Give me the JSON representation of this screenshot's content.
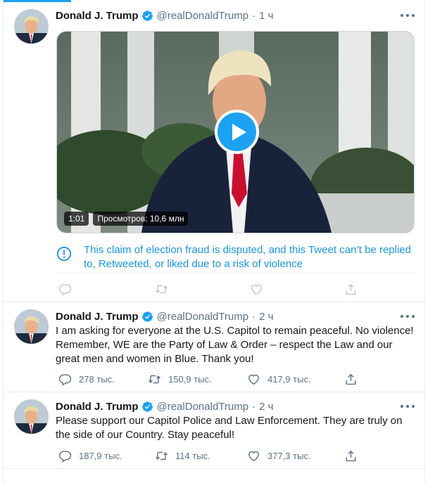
{
  "tweets": [
    {
      "name": "Donald J. Trump",
      "handle": "@realDonaldTrump",
      "time": "1 ч",
      "video": {
        "duration": "1:01",
        "views": "Просмотров: 10,6 млн"
      },
      "notice": "This claim of election fraud is disputed, and this Tweet can’t be replied to, Retweeted, or liked due to a risk of violence"
    },
    {
      "name": "Donald J. Trump",
      "handle": "@realDonaldTrump",
      "time": "2 ч",
      "text": "I am asking for everyone at the U.S. Capitol to remain peaceful. No violence! Remember, WE are the Party of Law & Order – respect the Law and our great men and women in Blue. Thank you!",
      "replies": "278 тыс.",
      "retweets": "150,9 тыс.",
      "likes": "417,9 тыс."
    },
    {
      "name": "Donald J. Trump",
      "handle": "@realDonaldTrump",
      "time": "2 ч",
      "text": "Please support our Capitol Police and Law Enforcement. They are truly on the side of our Country. Stay peaceful!",
      "replies": "187,9 тыс.",
      "retweets": "114 тыс.",
      "likes": "377,3 тыс."
    }
  ],
  "icons": {
    "verified": "verified-badge-icon",
    "more": "more-options-icon",
    "reply": "reply-icon",
    "retweet": "retweet-icon",
    "like": "like-icon",
    "share": "share-icon",
    "play": "play-icon",
    "warning": "warning-icon"
  },
  "colors": {
    "accent": "#1da1f2",
    "link": "#1b95e0",
    "muted": "#5b7083",
    "border": "#e6ecf0"
  }
}
